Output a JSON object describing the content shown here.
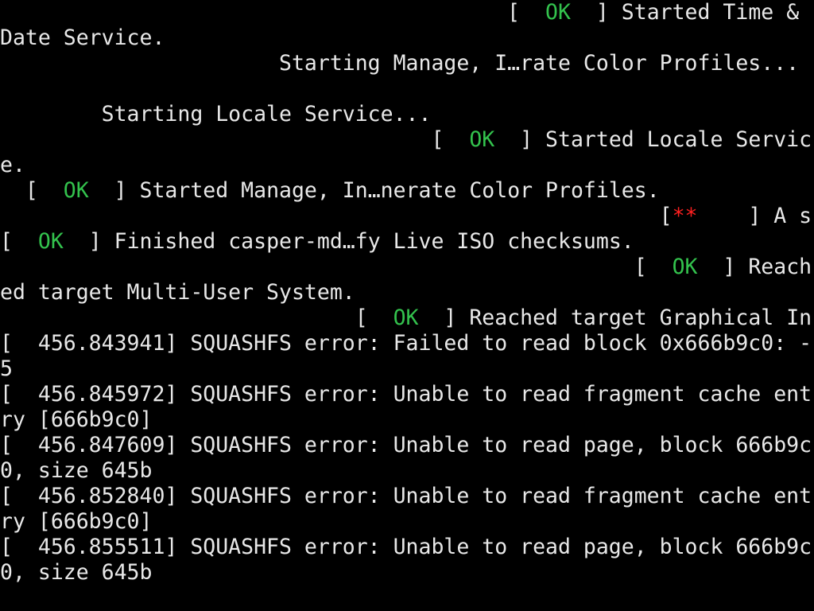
{
  "colors": {
    "background": "#000000",
    "text": "#e8e8e8",
    "ok": "#33c24d",
    "asterisk": "#ff2020"
  },
  "lines": [
    {
      "pre": "                                        [  ",
      "status": "OK",
      "post": "  ] Started Time &"
    },
    {
      "pre": "Date Service."
    },
    {
      "pre": "                      Starting Manage, I…rate Color Profiles..."
    },
    {
      "pre": ""
    },
    {
      "pre": "        Starting Locale Service..."
    },
    {
      "pre": "                                  [  ",
      "status": "OK",
      "post": "  ] Started Locale Servic"
    },
    {
      "pre": "e."
    },
    {
      "pre": "  [  ",
      "status": "OK",
      "post": "  ] Started Manage, In…nerate Color Profiles."
    },
    {
      "pre": "                                                    [",
      "fail": "**",
      "post": "    ] A s"
    },
    {
      "pre": "[  ",
      "status": "OK",
      "post": "  ] Finished casper-md…fy Live ISO checksums."
    },
    {
      "pre": "                                                  [  ",
      "status": "OK",
      "post": "  ] Reach"
    },
    {
      "pre": "ed target Multi-User System."
    },
    {
      "pre": "                            [  ",
      "status": "OK",
      "post": "  ] Reached target Graphical In"
    },
    {
      "pre": "[  456.843941] SQUASHFS error: Failed to read block 0x666b9c0: -"
    },
    {
      "pre": "5"
    },
    {
      "pre": "[  456.845972] SQUASHFS error: Unable to read fragment cache ent"
    },
    {
      "pre": "ry [666b9c0]"
    },
    {
      "pre": "[  456.847609] SQUASHFS error: Unable to read page, block 666b9c"
    },
    {
      "pre": "0, size 645b"
    },
    {
      "pre": "[  456.852840] SQUASHFS error: Unable to read fragment cache ent"
    },
    {
      "pre": "ry [666b9c0]"
    },
    {
      "pre": "[  456.855511] SQUASHFS error: Unable to read page, block 666b9c"
    },
    {
      "pre": "0, size 645b"
    }
  ]
}
